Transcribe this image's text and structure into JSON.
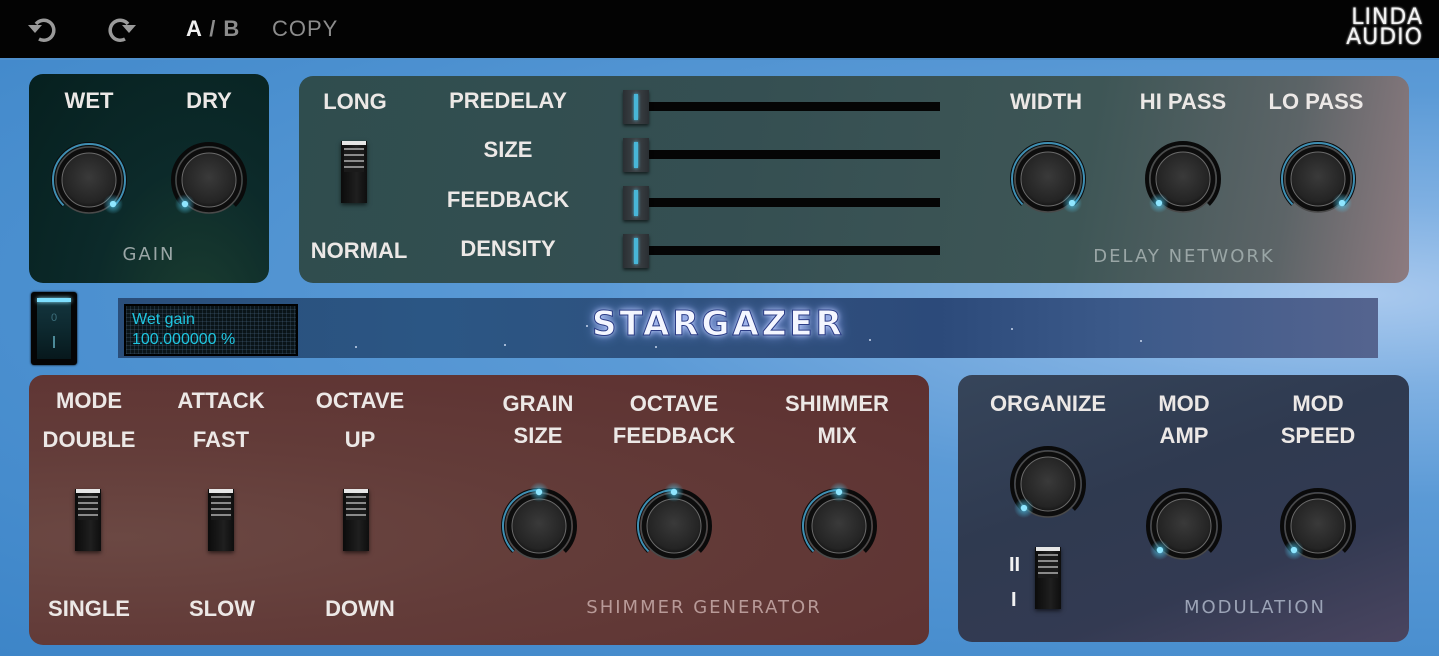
{
  "topbar": {
    "undo_icon": "undo-icon",
    "redo_icon": "redo-icon",
    "ab_a": "A",
    "ab_sep": " / ",
    "ab_b": "B",
    "copy": "COPY",
    "logo_line1": "LINDA",
    "logo_line2": "AUDIO"
  },
  "gain": {
    "section_label": "GAIN",
    "knobs": [
      {
        "label": "WET",
        "value": 1.0
      },
      {
        "label": "DRY",
        "value": 0.0
      }
    ]
  },
  "delay": {
    "section_label": "DELAY NETWORK",
    "toggle": {
      "top_label": "LONG",
      "bottom_label": "NORMAL",
      "state": "LONG"
    },
    "sliders": [
      {
        "label": "PREDELAY",
        "value": 0.0
      },
      {
        "label": "SIZE",
        "value": 0.0
      },
      {
        "label": "FEEDBACK",
        "value": 0.0
      },
      {
        "label": "DENSITY",
        "value": 0.0
      }
    ],
    "knobs": [
      {
        "label": "WIDTH",
        "value": 1.0
      },
      {
        "label": "HI PASS",
        "value": 0.0
      },
      {
        "label": "LO PASS",
        "value": 1.0
      }
    ]
  },
  "display": {
    "power_on_label": "0",
    "param_name": "Wet gain",
    "param_value": "100.000000 %",
    "title": "STARGAZER"
  },
  "shimmer": {
    "section_label": "SHIMMER GENERATOR",
    "toggles": [
      {
        "label": "MODE",
        "top_label": "DOUBLE",
        "bottom_label": "SINGLE",
        "state": "DOUBLE"
      },
      {
        "label": "ATTACK",
        "top_label": "FAST",
        "bottom_label": "SLOW",
        "state": "FAST"
      },
      {
        "label": "OCTAVE",
        "top_label": "UP",
        "bottom_label": "DOWN",
        "state": "UP"
      }
    ],
    "knobs": [
      {
        "label1": "GRAIN",
        "label2": "SIZE",
        "value": 0.5
      },
      {
        "label1": "OCTAVE",
        "label2": "FEEDBACK",
        "value": 0.5
      },
      {
        "label1": "SHIMMER",
        "label2": "MIX",
        "value": 0.5
      }
    ]
  },
  "modulation": {
    "section_label": "MODULATION",
    "organize": {
      "label": "ORGANIZE",
      "value": 0.0
    },
    "mode_toggle": {
      "top_label": "II",
      "bottom_label": "I",
      "state": "II"
    },
    "knobs": [
      {
        "label1": "MOD",
        "label2": "AMP",
        "value": 0.0
      },
      {
        "label1": "MOD",
        "label2": "SPEED",
        "value": 0.0
      }
    ]
  },
  "colors": {
    "accent": "#4fc6ea",
    "lcd_text": "#1fc6e0"
  }
}
